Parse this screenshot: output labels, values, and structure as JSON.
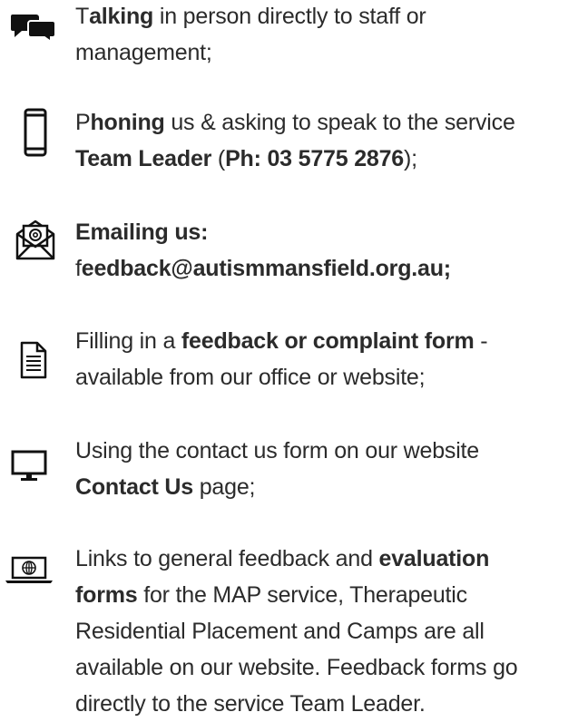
{
  "items": [
    {
      "icon": "chat-bubbles-icon",
      "line1": [
        {
          "t": "T",
          "b": false
        },
        {
          "t": "alking",
          "b": true
        },
        {
          "t": " in person directly to staff or",
          "b": false
        }
      ],
      "line2": [
        {
          "t": "management;",
          "b": false
        }
      ]
    },
    {
      "icon": "mobile-phone-icon",
      "line1": [
        {
          "t": "P",
          "b": false
        },
        {
          "t": "honing",
          "b": true
        },
        {
          "t": " us & asking to speak to the service",
          "b": false
        }
      ],
      "line2": [
        {
          "t": "Team Leader",
          "b": true
        },
        {
          "t": " (",
          "b": false
        },
        {
          "t": "Ph: 03 5775 2876",
          "b": true
        },
        {
          "t": ");",
          "b": false
        }
      ]
    },
    {
      "icon": "email-envelope-icon",
      "line1": [
        {
          "t": "Emailing us:",
          "b": true
        }
      ],
      "line2": [
        {
          "t": "f",
          "b": false
        },
        {
          "t": "eedback@autismmansfield.org.au;",
          "b": true
        }
      ]
    },
    {
      "icon": "document-form-icon",
      "line1": [
        {
          "t": "Filling in a ",
          "b": false
        },
        {
          "t": "feedback or complaint form",
          "b": true
        },
        {
          "t": " -",
          "b": false
        }
      ],
      "line2": [
        {
          "t": "available from our office or website;",
          "b": false
        }
      ]
    },
    {
      "icon": "desktop-monitor-icon",
      "line1": [
        {
          "t": "Using the contact us form on our website",
          "b": false
        }
      ],
      "line2": [
        {
          "t": "Contact Us",
          "b": true
        },
        {
          "t": " page;",
          "b": false
        }
      ]
    },
    {
      "icon": "laptop-globe-icon",
      "line1": [
        {
          "t": "Links to general feedback and ",
          "b": false
        },
        {
          "t": "evaluation",
          "b": true
        }
      ],
      "line2": [
        {
          "t": "forms",
          "b": true
        },
        {
          "t": " for the MAP service, Therapeutic",
          "b": false
        }
      ],
      "line3": [
        {
          "t": "Residential Placement and Camps are all",
          "b": false
        }
      ],
      "line4": [
        {
          "t": "available on our website. Feedback forms go",
          "b": false
        }
      ],
      "line5": [
        {
          "t": "directly to the service Team Leader.",
          "b": false
        }
      ]
    }
  ]
}
